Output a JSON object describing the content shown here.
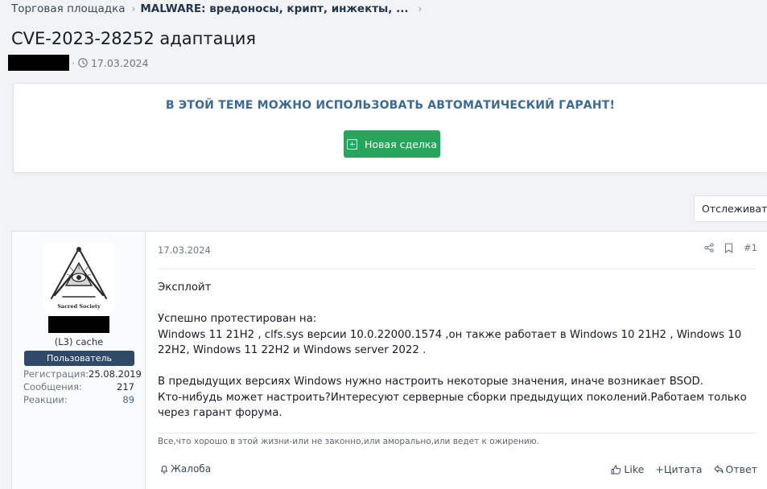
{
  "breadcrumb": {
    "items": [
      "Торговая площадка",
      "MALWARE: вредоносы, крипт, инжекты, ..."
    ]
  },
  "thread": {
    "title": "CVE-2023-28252 адаптация",
    "date": "17.03.2024"
  },
  "notice": {
    "text": "В ЭТОЙ ТЕМЕ МОЖНО ИСПОЛЬЗОВАТЬ АВТОМАТИЧЕСКИЙ ГАРАНТ!",
    "button_label": "Новая сделка"
  },
  "watch_label": "Отслеживать",
  "post": {
    "date": "17.03.2024",
    "number": "#1",
    "author": {
      "title": "(L3) cache",
      "badge": "Пользователь",
      "avatar_caption": "Sacred Society",
      "stats": [
        {
          "label": "Регистрация:",
          "value": "25.08.2019"
        },
        {
          "label": "Сообщения:",
          "value": "217"
        },
        {
          "label": "Реакции:",
          "value": "89"
        }
      ]
    },
    "body": {
      "line1": "Эксплойт",
      "line2": "Успешно протестирован на:",
      "line3": "Windows 11 21H2 , clfs.sys версии 10.0.22000.1574 ,он также работает в Windows 10 21H2 , Windows 10 22H2, Windows 11 22H2 и Windows server 2022 .",
      "line4": "В предыдущих версиях Windows нужно настроить некоторые значения, иначе возникает BSOD.",
      "line5": "Кто-нибудь может настроить?Интересуют серверные сборки предыдущих поколений.Работаем только через гарант форума."
    },
    "signature": "Все,что хорошо в этой жизни-или не законно,или аморально,или ведет к ожирению.",
    "report_label": "Жалоба",
    "like_label": "Like",
    "quote_label": "+Цитата",
    "reply_label": "Ответ"
  }
}
